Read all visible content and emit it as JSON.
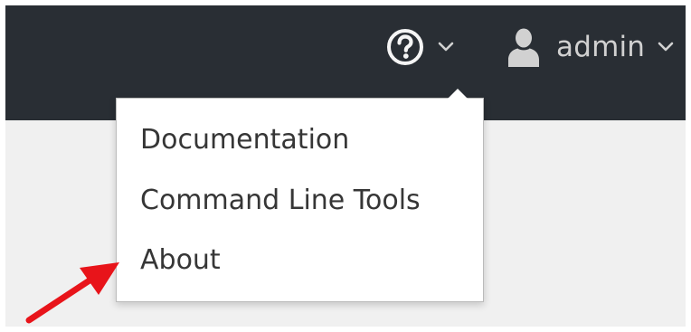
{
  "masthead": {
    "help_icon": "question-circle-icon",
    "help_caret_icon": "chevron-down-icon",
    "user_icon": "user-icon",
    "user_caret_icon": "chevron-down-icon",
    "username": "admin"
  },
  "help_menu": {
    "items": [
      {
        "label": "Documentation"
      },
      {
        "label": "Command Line Tools"
      },
      {
        "label": "About"
      }
    ]
  },
  "annotation": {
    "icon": "arrow-pointer",
    "color": "#e8141a"
  },
  "colors": {
    "masthead_bg": "#292e34",
    "page_bg": "#f0f0f0",
    "menu_bg": "#ffffff",
    "menu_text": "#363636",
    "icon_fill": "#d1d1d1"
  }
}
